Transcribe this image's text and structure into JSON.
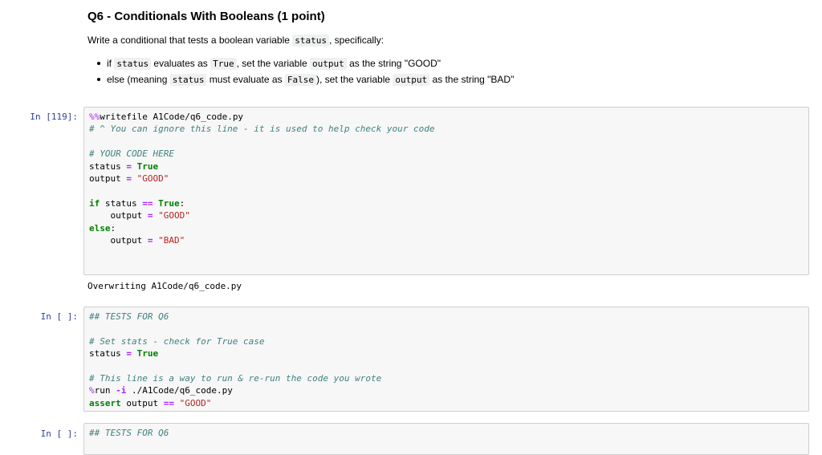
{
  "question": {
    "title": "Q6 - Conditionals With Booleans (1 point)",
    "intro_before": "Write a conditional that tests a boolean variable ",
    "intro_var": "status",
    "intro_after": ", specifically:",
    "bullet1": {
      "a": "if ",
      "b": "status",
      "c": " evaluates as ",
      "d": "True",
      "e": ", set the variable ",
      "f": "output",
      "g": " as the string \"GOOD\""
    },
    "bullet2": {
      "a": "else (meaning ",
      "b": "status",
      "c": " must evaluate as ",
      "d": "False",
      "e": "), set the variable ",
      "f": "output",
      "g": " as the string \"BAD\""
    }
  },
  "cell1": {
    "prompt": "In [119]:",
    "l1_magic": "%%",
    "l1_rest": "writefile A1Code/q6_code.py",
    "l2": "# ^ You can ignore this line - it is used to help check your code",
    "l4": "# YOUR CODE HERE",
    "var_status": "status",
    "var_output": "output",
    "eq": "=",
    "eqeq": "==",
    "true_kw": "True",
    "good": "\"GOOD\"",
    "bad": "\"BAD\"",
    "if_kw": "if",
    "else_kw": "else",
    "colon": ":",
    "output_text": "Overwriting A1Code/q6_code.py"
  },
  "cell2": {
    "prompt": "In [ ]:",
    "l1": "## TESTS FOR Q6",
    "l3": "# Set stats - check for True case",
    "l6": "# This line is a way to run & re-run the code you wrote",
    "run_pct": "%",
    "run_kw": "run",
    "run_flag": "-i",
    "run_path": " ./A1Code/q6_code.py",
    "assert_kw": "assert"
  },
  "cell3": {
    "prompt": "In [ ]:",
    "l1": "## TESTS FOR Q6"
  }
}
